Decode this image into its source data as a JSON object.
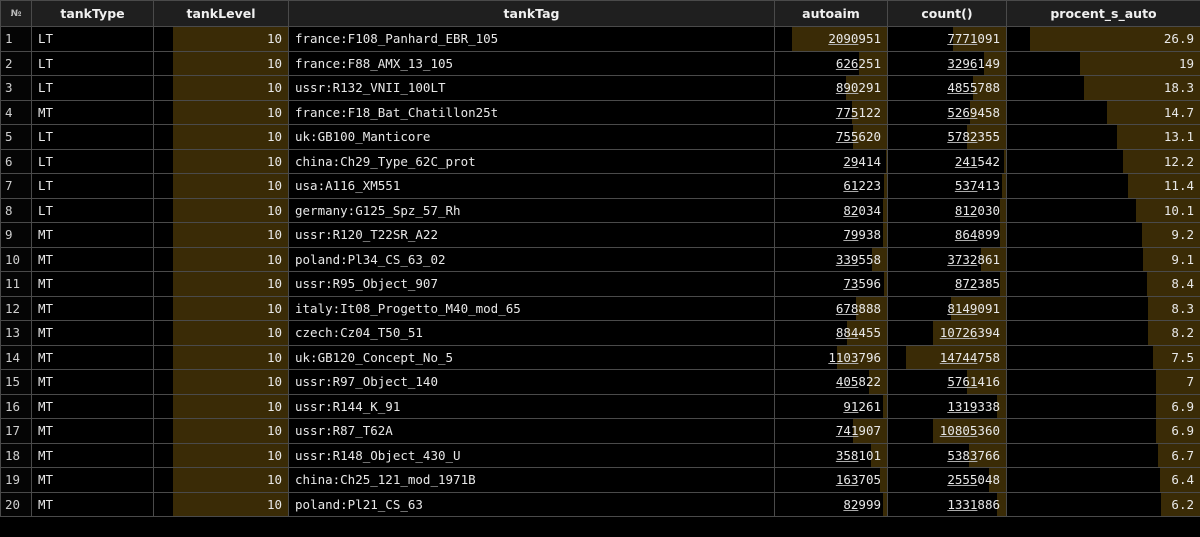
{
  "columns": [
    "№",
    "tankType",
    "tankLevel",
    "tankTag",
    "autoaim",
    "count()",
    "procent_s_auto"
  ],
  "rows": [
    {
      "n": "1",
      "type": "LT",
      "level": "10",
      "tag": "france:F108_Panhard_EBR_105",
      "autoaim": "2090951",
      "count": "7771091",
      "pct": "26.9"
    },
    {
      "n": "2",
      "type": "LT",
      "level": "10",
      "tag": "france:F88_AMX_13_105",
      "autoaim": "626251",
      "count": "3296149",
      "pct": "19"
    },
    {
      "n": "3",
      "type": "LT",
      "level": "10",
      "tag": "ussr:R132_VNII_100LT",
      "autoaim": "890291",
      "count": "4855788",
      "pct": "18.3"
    },
    {
      "n": "4",
      "type": "MT",
      "level": "10",
      "tag": "france:F18_Bat_Chatillon25t",
      "autoaim": "775122",
      "count": "5269458",
      "pct": "14.7"
    },
    {
      "n": "5",
      "type": "LT",
      "level": "10",
      "tag": "uk:GB100_Manticore",
      "autoaim": "755620",
      "count": "5782355",
      "pct": "13.1"
    },
    {
      "n": "6",
      "type": "LT",
      "level": "10",
      "tag": "china:Ch29_Type_62C_prot",
      "autoaim": "29414",
      "count": "241542",
      "pct": "12.2"
    },
    {
      "n": "7",
      "type": "LT",
      "level": "10",
      "tag": "usa:A116_XM551",
      "autoaim": "61223",
      "count": "537413",
      "pct": "11.4"
    },
    {
      "n": "8",
      "type": "LT",
      "level": "10",
      "tag": "germany:G125_Spz_57_Rh",
      "autoaim": "82034",
      "count": "812030",
      "pct": "10.1"
    },
    {
      "n": "9",
      "type": "MT",
      "level": "10",
      "tag": "ussr:R120_T22SR_A22",
      "autoaim": "79938",
      "count": "864899",
      "pct": "9.2"
    },
    {
      "n": "10",
      "type": "MT",
      "level": "10",
      "tag": "poland:Pl34_CS_63_02",
      "autoaim": "339558",
      "count": "3732861",
      "pct": "9.1"
    },
    {
      "n": "11",
      "type": "MT",
      "level": "10",
      "tag": "ussr:R95_Object_907",
      "autoaim": "73596",
      "count": "872385",
      "pct": "8.4"
    },
    {
      "n": "12",
      "type": "MT",
      "level": "10",
      "tag": "italy:It08_Progetto_M40_mod_65",
      "autoaim": "678888",
      "count": "8149091",
      "pct": "8.3"
    },
    {
      "n": "13",
      "type": "MT",
      "level": "10",
      "tag": "czech:Cz04_T50_51",
      "autoaim": "884455",
      "count": "10726394",
      "pct": "8.2"
    },
    {
      "n": "14",
      "type": "MT",
      "level": "10",
      "tag": "uk:GB120_Concept_No_5",
      "autoaim": "1103796",
      "count": "14744758",
      "pct": "7.5"
    },
    {
      "n": "15",
      "type": "MT",
      "level": "10",
      "tag": "ussr:R97_Object_140",
      "autoaim": "405822",
      "count": "5761416",
      "pct": "7"
    },
    {
      "n": "16",
      "type": "MT",
      "level": "10",
      "tag": "ussr:R144_K_91",
      "autoaim": "91261",
      "count": "1319338",
      "pct": "6.9"
    },
    {
      "n": "17",
      "type": "MT",
      "level": "10",
      "tag": "ussr:R87_T62A",
      "autoaim": "741907",
      "count": "10805360",
      "pct": "6.9"
    },
    {
      "n": "18",
      "type": "MT",
      "level": "10",
      "tag": "ussr:R148_Object_430_U",
      "autoaim": "358101",
      "count": "5383766",
      "pct": "6.7"
    },
    {
      "n": "19",
      "type": "MT",
      "level": "10",
      "tag": "china:Ch25_121_mod_1971B",
      "autoaim": "163705",
      "count": "2555048",
      "pct": "6.4"
    },
    {
      "n": "20",
      "type": "MT",
      "level": "10",
      "tag": "poland:Pl21_CS_63",
      "autoaim": "82999",
      "count": "1331886",
      "pct": "6.2"
    }
  ],
  "colors": {
    "bar": "#3a2b06",
    "background": "#000000",
    "header": "#1f1f1f",
    "grid": "#4a4a4a"
  }
}
